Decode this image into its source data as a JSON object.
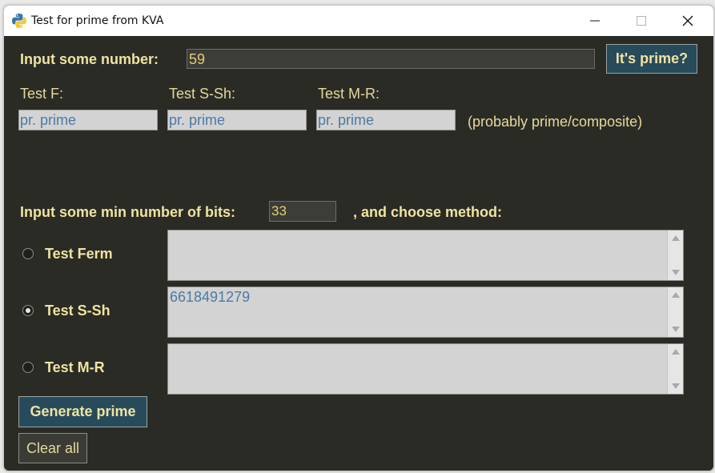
{
  "window": {
    "title": "Test for prime from KVA",
    "icon": "python-icon",
    "controls": [
      "minimize-icon",
      "maximize-icon",
      "close-icon"
    ]
  },
  "number_input": {
    "label": "Input some number:",
    "value": "59"
  },
  "prime_button": {
    "label": "It's prime?"
  },
  "tests": [
    {
      "label": "Test F:",
      "result": "pr. prime"
    },
    {
      "label": "Test S-Sh:",
      "result": "pr. prime"
    },
    {
      "label": "Test M-R:",
      "result": "pr. prime"
    }
  ],
  "result_hint": "(probably prime/composite)",
  "bits": {
    "label": "Input some min number of bits:",
    "value": "33",
    "method_label": ", and choose method:"
  },
  "methods": [
    {
      "label": "Test Ferm",
      "selected": false,
      "output": ""
    },
    {
      "label": "Test S-Sh",
      "selected": true,
      "output": "6618491279"
    },
    {
      "label": "Test M-R",
      "selected": false,
      "output": ""
    }
  ],
  "generate_button": {
    "label": "Generate prime"
  },
  "clear_button": {
    "label": "Clear all"
  },
  "colors": {
    "background": "#2b2b26",
    "label_text": "#efe3a0",
    "button_bg": "#284b5b",
    "field_bg": "#d3d3d3",
    "field_text": "#4b7aa6"
  }
}
